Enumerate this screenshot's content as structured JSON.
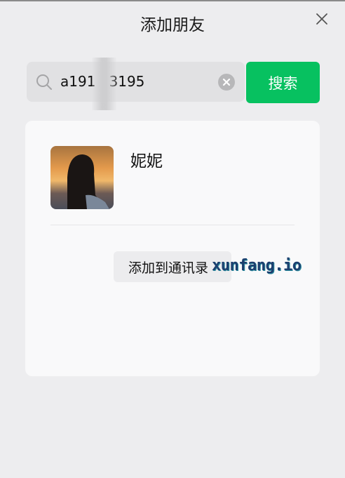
{
  "window": {
    "title": "添加朋友",
    "close_icon": "close-icon"
  },
  "search": {
    "icon": "search-icon",
    "value": "a191   3195",
    "clear_icon": "clear-circle-icon",
    "button_label": "搜索",
    "button_color": "#07c160"
  },
  "result": {
    "avatar_icon": "user-avatar-photo",
    "name": "妮妮",
    "add_button_label": "添加到通讯录"
  },
  "watermark": {
    "text": "xunfang.io"
  }
}
